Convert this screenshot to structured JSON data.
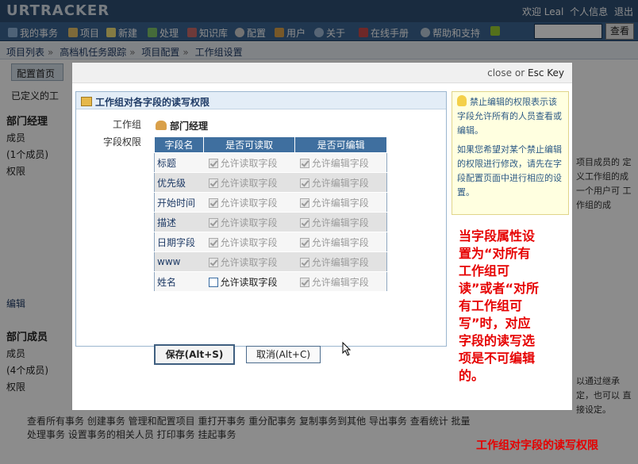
{
  "app": {
    "logo": "URTRACKER"
  },
  "toplinks": {
    "greeting": "欢迎 Leal",
    "profile": "个人信息",
    "logout": "退出"
  },
  "nav": {
    "items": [
      "我的事务",
      "项目",
      "新建",
      "处理",
      "知识库",
      "配置",
      "用户",
      "关于",
      "在线手册",
      "帮助和支持"
    ],
    "search_button": "查看"
  },
  "breadcrumb": [
    "项目列表",
    "高档机任务跟踪",
    "项目配置",
    "工作组设置"
  ],
  "background": {
    "tab": "配置首页",
    "defined": "已定义的工",
    "sections": [
      {
        "title": "部门经理",
        "members": "成员",
        "count": "(1个成员)",
        "perm": "权限"
      },
      {
        "title": "部门成员",
        "members": "成员",
        "count": "(4个成员)",
        "perm": "权限"
      }
    ],
    "edit_link": "编辑",
    "right_text_1": "项目成员的 定义工作组的成 一个用户可 工作组的成",
    "right_text_2": "以通过继承 定，也可以 直接设定。",
    "bottom_perms": "查看所有事务 创建事务 管理和配置项目 重打开事务 重分配事务 复制事务到其他 导出事务 查看统计 批量处理事务 设置事务的相关人员 打印事务 挂起事务"
  },
  "modal": {
    "close_hint_prefix": "close",
    "close_hint_or": "or",
    "close_hint_key": "Esc Key",
    "panel_title": "工作组对各字段的读写权限",
    "workgroup_label": "工作组",
    "workgroup_value": "部门经理",
    "field_perm_label": "字段权限",
    "table": {
      "headers": [
        "字段名",
        "是否可读取",
        "是否可编辑"
      ],
      "rows": [
        {
          "field": "标题",
          "read": "允许读取字段",
          "edit": "允许编辑字段",
          "read_checked": true,
          "edit_checked": true,
          "read_enabled": false
        },
        {
          "field": "优先级",
          "read": "允许读取字段",
          "edit": "允许编辑字段",
          "read_checked": true,
          "edit_checked": true,
          "read_enabled": false
        },
        {
          "field": "开始时间",
          "read": "允许读取字段",
          "edit": "允许编辑字段",
          "read_checked": true,
          "edit_checked": true,
          "read_enabled": false
        },
        {
          "field": "描述",
          "read": "允许读取字段",
          "edit": "允许编辑字段",
          "read_checked": true,
          "edit_checked": true,
          "read_enabled": false
        },
        {
          "field": "日期字段",
          "read": "允许读取字段",
          "edit": "允许编辑字段",
          "read_checked": true,
          "edit_checked": true,
          "read_enabled": false
        },
        {
          "field": "www",
          "read": "允许读取字段",
          "edit": "允许编辑字段",
          "read_checked": true,
          "edit_checked": true,
          "read_enabled": false
        },
        {
          "field": "姓名",
          "read": "允许读取字段",
          "edit": "允许编辑字段",
          "read_checked": false,
          "edit_checked": true,
          "read_enabled": true
        }
      ]
    },
    "save_button": "保存(Alt+S)",
    "cancel_button": "取消(Alt+C)",
    "tip": {
      "p1": "禁止编辑的权限表示该字段允许所有的人员查看或编辑。",
      "p2": "如果您希望对某个禁止编辑的权限进行修改，请先在字段配置页面中进行相应的设置。"
    }
  },
  "annotation": "当字段属性设置为“对所有工作组可读”或者“对所有工作组可写”时，对应字段的读写选项是不可编辑的。",
  "caption": "工作组对字段的读写权限",
  "colors": {
    "topbar": "#2f4f74",
    "navbar": "#3b6592",
    "header_row": "#3f6f9f",
    "annotation": "#e60000"
  }
}
